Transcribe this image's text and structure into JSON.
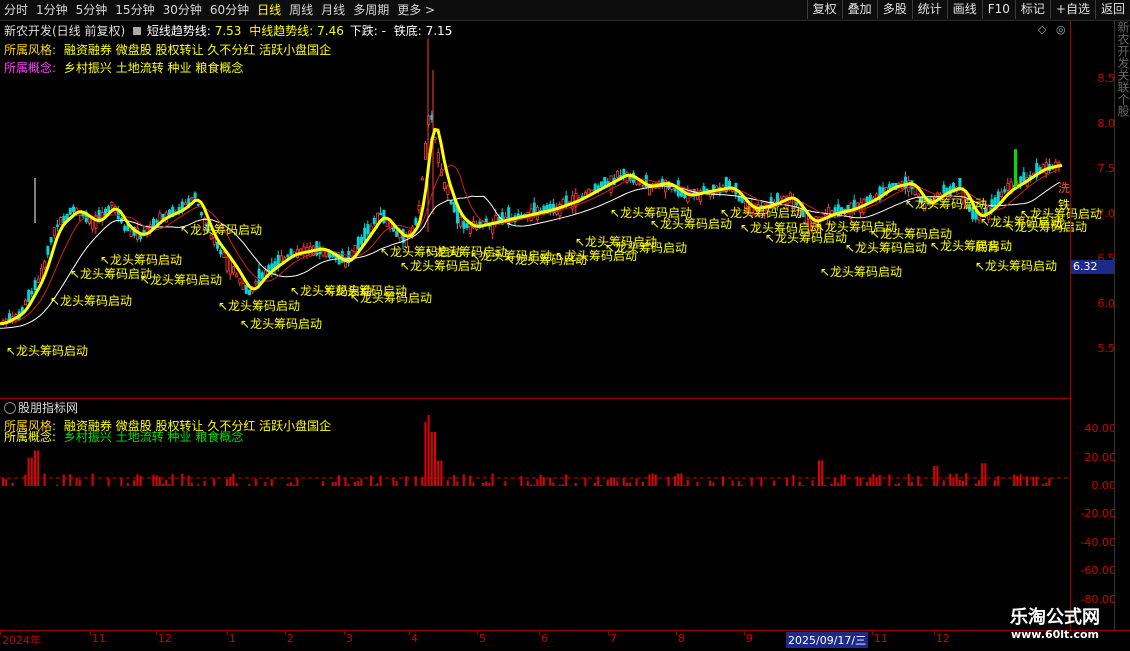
{
  "toolbar": {
    "period_tabs": [
      "分时",
      "1分钟",
      "5分钟",
      "15分钟",
      "30分钟",
      "60分钟",
      "日线",
      "周线",
      "月线",
      "多周期",
      "更多"
    ],
    "active_tab": "日线",
    "more_arrow": ">",
    "right_buttons": [
      "复权",
      "叠加",
      "多股",
      "统计",
      "画线",
      "F10",
      "标记",
      "+自选",
      "返回"
    ]
  },
  "main_panel": {
    "stock_title": "新农开发(日线 前复权)",
    "short_trend_label": "短线趋势线:",
    "short_trend_value": "7.53",
    "mid_trend_label": "中线趋势线:",
    "mid_trend_value": "7.46",
    "down_label": "下跌:",
    "down_value": "-",
    "iron_bottom_label": "铁底:",
    "iron_bottom_value": "7.15",
    "style_label": "所属风格:",
    "style_value": "融资融券 微盘股 股权转让 久不分红 活跃小盘国企",
    "concept_label": "所属概念:",
    "concept_value": "乡村振兴 土地流转 种业 粮食概念",
    "signal_text": "龙头筹码启动",
    "signal_text_other": "底背",
    "right_edge_marks": [
      "洗",
      "铁",
      "龙"
    ],
    "price_axis": [
      "8.50",
      "8.00",
      "7.50",
      "7.00",
      "6.50",
      "6.00",
      "5.50"
    ],
    "current_price_tag": "6.32",
    "colors": {
      "short_trend": "#ffff00",
      "mid_trend": "#ffffff",
      "up_candle": "#ff3c3c",
      "down_candle": "#00d6d6",
      "signal": "#ffff00",
      "volume": "#e00000"
    }
  },
  "sub_panel": {
    "title": "股朋指标网",
    "style_label": "所属风格:",
    "style_value": "融资融券 微盘股 股权转让 久不分红 活跃小盘国企",
    "concept_label": "所属概念:",
    "concept_value": "乡村振兴 土地流转 种业 粮食概念",
    "axis": [
      "40.00",
      "20.00",
      "0.00",
      "-20.00",
      "-40.00",
      "-60.00",
      "-80.00"
    ]
  },
  "date_axis": {
    "labels": [
      "2024年",
      "11",
      "12",
      "1",
      "2",
      "3",
      "4",
      "5",
      "6",
      "7",
      "8",
      "9",
      "2025/09/17/三",
      "11",
      "12"
    ]
  },
  "side_strip": "新农开发关联个股",
  "watermark": {
    "line1": "乐淘公式网",
    "line2": "www.60lt.com"
  }
}
